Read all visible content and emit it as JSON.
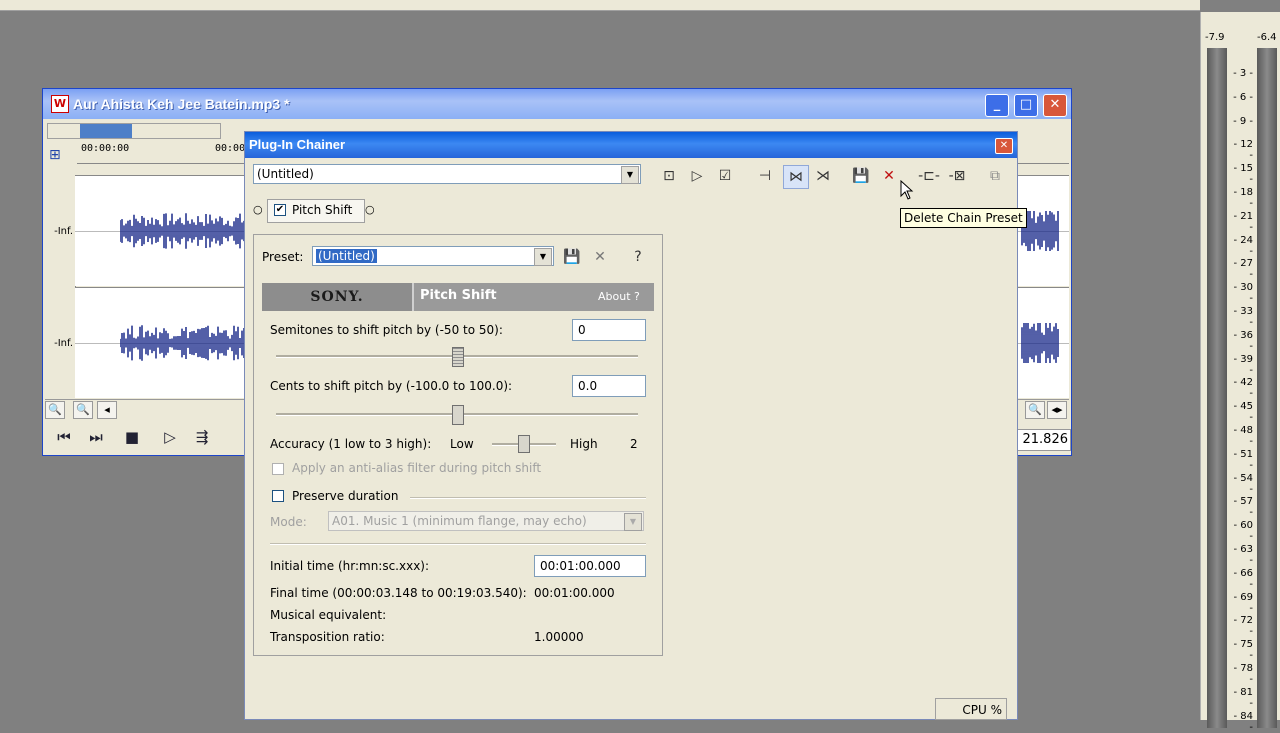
{
  "wave_window": {
    "title": "Aur Ahista Keh Jee Batein.mp3 *",
    "ruler_labels": [
      "00:00:00",
      "00:00"
    ],
    "track_levels": [
      "-Inf.",
      "-Inf."
    ],
    "time_readout": "21.826"
  },
  "meters": {
    "peak_left": "-7.9",
    "peak_right": "-6.4",
    "scale": [
      "3",
      "6",
      "9",
      "12",
      "15",
      "18",
      "21",
      "24",
      "27",
      "30",
      "33",
      "36",
      "39",
      "42",
      "45",
      "48",
      "51",
      "54",
      "57",
      "60",
      "63",
      "66",
      "69",
      "72",
      "75",
      "78",
      "81",
      "84"
    ]
  },
  "chainer": {
    "title": "Plug-In Chainer",
    "chain_preset_value": "(Untitled)",
    "chain_item_label": "Pitch Shift",
    "tooltip": "Delete Chain Preset",
    "cpu_label": "CPU %",
    "plugin": {
      "preset_label": "Preset:",
      "preset_value": "(Untitled)",
      "brand": "SONY.",
      "name": "Pitch Shift",
      "about": "About ?",
      "semitones_label": "Semitones to shift pitch by (-50 to 50):",
      "semitones_value": "0",
      "cents_label": "Cents to shift pitch by (-100.0 to 100.0):",
      "cents_value": "0.0",
      "accuracy_label": "Accuracy (1 low to 3 high):",
      "accuracy_low": "Low",
      "accuracy_high": "High",
      "accuracy_value": "2",
      "antialias_label": "Apply an anti-alias filter during pitch shift",
      "preserve_label": "Preserve duration",
      "mode_label": "Mode:",
      "mode_value": "A01. Music 1 (minimum flange, may echo)",
      "initial_label": "Initial time (hr:mn:sc.xxx):",
      "initial_value": "00:01:00.000",
      "final_label": "Final time (00:00:03.148 to 00:19:03.540):",
      "final_value": "00:01:00.000",
      "musical_label": "Musical equivalent:",
      "transposition_label": "Transposition ratio:",
      "transposition_value": "1.00000"
    }
  },
  "colors": {
    "xp_title_blue": "#0a5ddc",
    "waveform": "#1a2a8a",
    "dialog_bg": "#ece9d8"
  }
}
